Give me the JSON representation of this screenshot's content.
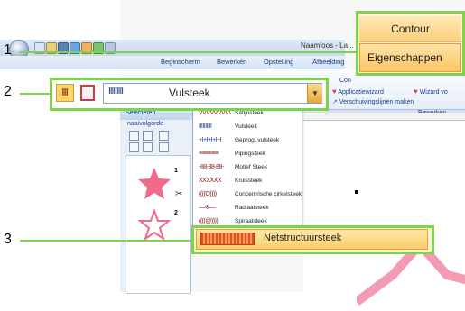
{
  "callouts": {
    "one": "1",
    "two": "2",
    "three": "3"
  },
  "ribbon": {
    "title": "Naamloos - La...",
    "tabs": [
      "Beginscherm",
      "Bewerken",
      "Opstelling",
      "Afbeelding"
    ],
    "items": {
      "con": "Con",
      "applicatiewizard": "Applicatiewizard",
      "wizard": "Wizard vo",
      "verschuivingslijnen": "Verschuivingslijnen maken"
    },
    "groups": {
      "selecteren": "Selecteren",
      "bewerken": "Bewerken"
    }
  },
  "panel": {
    "title": "naaivolgorde",
    "seq": [
      "1",
      "2"
    ]
  },
  "callout1": {
    "contour": "Contour",
    "eigenschappen": "Eigenschappen"
  },
  "callout2": {
    "stitch_icon": "IIIIIIIII",
    "selected_stitch": "Vulsteek",
    "arrow": "▼"
  },
  "dropdown": {
    "items": [
      {
        "icon": "VVVVVVVVV",
        "label": "Satijnsteek"
      },
      {
        "icon": "IIIIIIIIII",
        "label": "Vulsteek"
      },
      {
        "icon": "+I+I+I+I+I",
        "label": "Geprog. vulsteek"
      },
      {
        "icon": "≡≡≡≡≡≡",
        "label": "Pipingsteek"
      },
      {
        "icon": "-88-88-88-",
        "label": "Motief Steek"
      },
      {
        "icon": "XXXXXX",
        "label": "Kruissteek"
      },
      {
        "icon": "((((O))))",
        "label": "Concentrische cirkelsteek"
      },
      {
        "icon": "—※—",
        "label": "Radiaalsteek"
      },
      {
        "icon": "((((@))))",
        "label": "Spiraalsteek"
      }
    ]
  },
  "callout3": {
    "label": "Netstructuursteek"
  },
  "colors": {
    "callout_border": "#7fd34a",
    "highlight": "#fccd6c",
    "star_pink": "#f06a8c"
  }
}
